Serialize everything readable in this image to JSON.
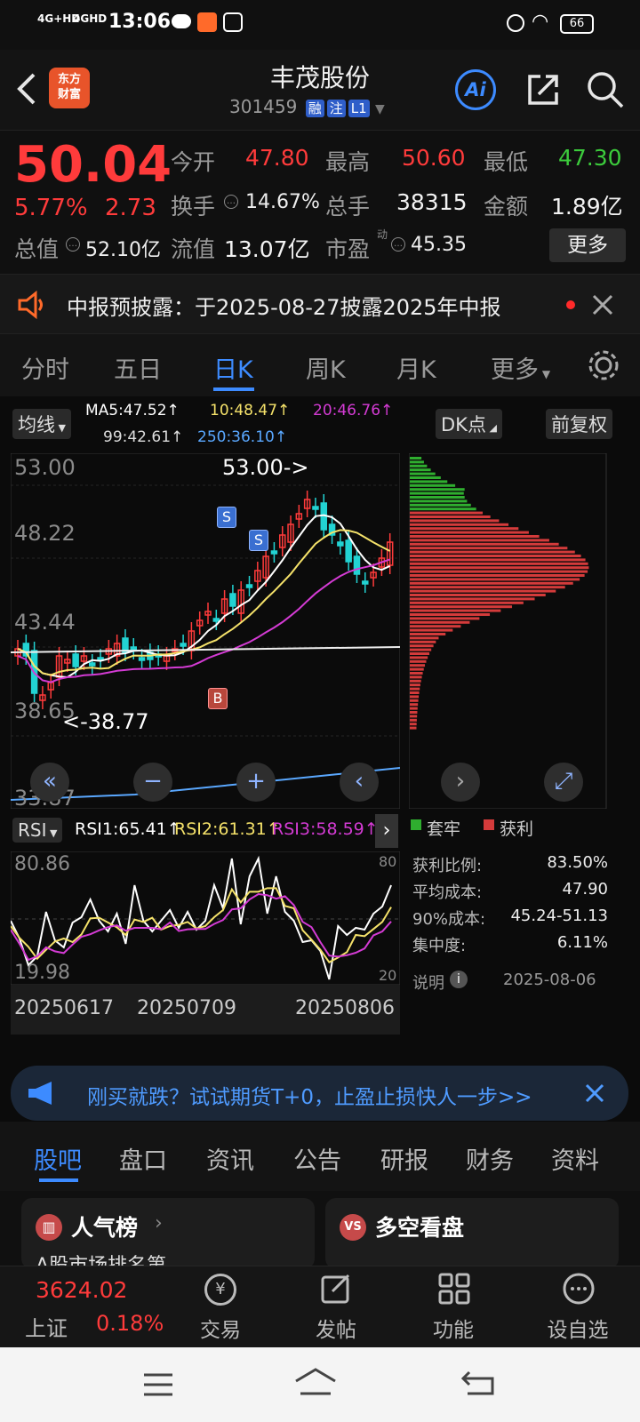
{
  "status": {
    "net1": "4G+HD",
    "net2": "4GHD",
    "time": "13:06",
    "battery": "66"
  },
  "header": {
    "logo_line1": "东方",
    "logo_line2": "财富",
    "title": "丰茂股份",
    "code": "301459",
    "tags": [
      "融",
      "注",
      "L1"
    ],
    "ai_label": "Ai"
  },
  "quote": {
    "price": "50.04",
    "pct": "5.77%",
    "chg": "2.73",
    "open_label": "今开",
    "open": "47.80",
    "high_label": "最高",
    "high": "50.60",
    "low_label": "最低",
    "low": "47.30",
    "turnover_label": "换手",
    "turnover": "14.67%",
    "volume_label": "总手",
    "volume": "38315",
    "amount_label": "金额",
    "amount": "1.89亿",
    "mcap_label": "总值",
    "mcap": "52.10亿",
    "float_label": "流值",
    "float": "13.07亿",
    "pe_label": "市盈",
    "pe_sup": "动",
    "pe": "45.35",
    "more": "更多"
  },
  "notice": {
    "text": "中报预披露：于2025-08-27披露2025年中报"
  },
  "ktabs": [
    "分时",
    "五日",
    "日K",
    "周K",
    "月K",
    "更多"
  ],
  "ktab_active": 2,
  "chart": {
    "ma_type": "均线",
    "ma5": "MA5:47.52↑",
    "ma10": "10:48.47↑",
    "ma20": "20:46.76↑",
    "ma99": "99:42.61↑",
    "ma250": "250:36.10↑",
    "dk": "DK点",
    "adjust": "前复权",
    "y_labels": [
      "53.00",
      "48.22",
      "43.44",
      "38.65",
      "33.87"
    ],
    "high_annot": "53.00->",
    "low_annot": "<-38.77",
    "signals": [
      "S",
      "S",
      "B"
    ],
    "rsi_type": "RSI",
    "rsi1": "RSI1:65.41↑",
    "rsi2": "RSI2:61.31↑",
    "rsi3": "RSI3:58.59↑",
    "rsi_y": [
      "80.86",
      "19.98"
    ],
    "rsi_y_right": [
      "80",
      "20"
    ],
    "dates": [
      "20250617",
      "20250709",
      "20250806"
    ]
  },
  "chips": {
    "legend_trapped": "套牢",
    "legend_profit": "获利",
    "rows": [
      {
        "label": "获利比例:",
        "value": "83.50%"
      },
      {
        "label": "平均成本:",
        "value": "47.90"
      },
      {
        "label": "90%成本:",
        "value": "45.24-51.13"
      },
      {
        "label": "集中度:",
        "value": "6.11%"
      }
    ],
    "note": "说明",
    "date": "2025-08-06"
  },
  "promo": {
    "text": "刚买就跌？试试期货T+0，止盈止损快人一步>>"
  },
  "btabs": [
    "股吧",
    "盘口",
    "资讯",
    "公告",
    "研报",
    "财务",
    "资料"
  ],
  "btab_active": 0,
  "cards": [
    {
      "title": "人气榜",
      "sub": "A股市场排名第"
    },
    {
      "title": "多空看盘"
    }
  ],
  "dock": {
    "index_value": "3624.02",
    "index_name": "上证",
    "index_pct": "0.18%",
    "items": [
      "交易",
      "发帖",
      "功能",
      "设自选"
    ]
  },
  "colors": {
    "up": "#ff3b3b",
    "down": "#3ccc3c",
    "accent": "#3d8bff",
    "ma5": "#ffffff",
    "ma10": "#f5e26a",
    "ma20": "#d43bd4",
    "ma250": "#5aa8ff"
  }
}
